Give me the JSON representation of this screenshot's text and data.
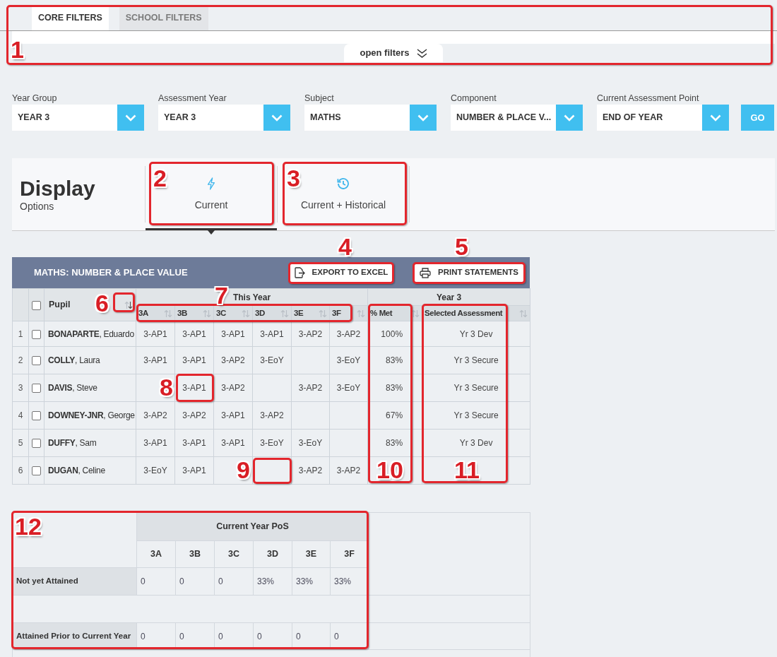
{
  "filter_tabs": [
    {
      "label": "CORE FILTERS",
      "selected": true
    },
    {
      "label": "SCHOOL FILTERS",
      "selected": false
    }
  ],
  "open_filters": "open filters",
  "filters": [
    {
      "label": "Year Group",
      "value": "YEAR 3"
    },
    {
      "label": "Assessment Year",
      "value": "YEAR 3"
    },
    {
      "label": "Subject",
      "value": "MATHS"
    },
    {
      "label": "Component",
      "value": "NUMBER & PLACE V..."
    },
    {
      "label": "Current Assessment Point",
      "value": "END OF YEAR"
    }
  ],
  "go_button": "GO",
  "display_options": {
    "title": "Display",
    "subtitle": "Options",
    "tabs": [
      {
        "label": "Current",
        "kind": "current",
        "selected": true
      },
      {
        "label": "Current + Historical",
        "kind": "historical",
        "selected": false
      }
    ]
  },
  "table": {
    "title": "MATHS: NUMBER & PLACE VALUE",
    "actions": [
      {
        "label": "EXPORT TO EXCEL",
        "kind": "export"
      },
      {
        "label": "PRINT STATEMENTS",
        "kind": "print"
      }
    ],
    "header_checkbox": {
      "checked": false
    },
    "pupil_column": {
      "label": "Pupil",
      "sorted": true
    },
    "column_groups": [
      {
        "label": "This Year",
        "columns": [
          {
            "label": "3A",
            "kind": "mark",
            "sorted": false
          },
          {
            "label": "3B",
            "kind": "mark",
            "sorted": false
          },
          {
            "label": "3C",
            "kind": "mark",
            "sorted": false
          },
          {
            "label": "3D",
            "kind": "mark",
            "sorted": false
          },
          {
            "label": "3E",
            "kind": "mark",
            "sorted": false
          },
          {
            "label": "3F",
            "kind": "mark",
            "sorted": false
          }
        ]
      },
      {
        "label": "Year 3",
        "columns": [
          {
            "label": "% Met",
            "kind": "percent",
            "sorted": false
          },
          {
            "label": "Selected Assessment",
            "kind": "assessment",
            "sorted": false
          }
        ]
      }
    ],
    "rows": [
      {
        "number": "1",
        "checked": false,
        "name": "**BONAPARTE**, Eduardo",
        "cells": [
          "3-AP1",
          "3-AP1",
          "3-AP1",
          "3-AP1",
          "3-AP2",
          "3-AP2",
          "100%",
          "Yr 3 Dev"
        ]
      },
      {
        "number": "2",
        "checked": false,
        "name": "**COLLY**, Laura",
        "cells": [
          "3-AP1",
          "3-AP1",
          "3-AP2",
          "3-EoY",
          null,
          "3-EoY",
          "83%",
          "Yr 3 Secure"
        ]
      },
      {
        "number": "3",
        "checked": false,
        "name": "**DAVIS**, Steve",
        "cells": [
          null,
          "3-AP1",
          "3-AP2",
          null,
          "3-AP2",
          "3-EoY",
          "83%",
          "Yr 3 Secure"
        ]
      },
      {
        "number": "4",
        "checked": false,
        "name": "**DOWNEY-JNR**, George",
        "cells": [
          "3-AP2",
          "3-AP2",
          "3-AP1",
          "3-AP2",
          null,
          null,
          "67%",
          "Yr 3 Secure"
        ]
      },
      {
        "number": "5",
        "checked": false,
        "name": "**DUFFY**, Sam",
        "cells": [
          "3-AP1",
          "3-AP1",
          "3-AP1",
          "3-EoY",
          "3-EoY",
          null,
          "83%",
          "Yr 3 Dev"
        ]
      },
      {
        "number": "6",
        "checked": false,
        "name": "**DUGAN**, Celine",
        "cells": [
          "3-EoY",
          "3-AP1",
          null,
          null,
          "3-AP2",
          "3-AP2",
          null,
          null
        ]
      }
    ]
  },
  "summary": {
    "column_group": "Current Year PoS",
    "columns": [
      "3A",
      "3B",
      "3C",
      "3D",
      "3E",
      "3F"
    ],
    "rows": [
      {
        "label": "Not yet Attained",
        "values": [
          "0",
          "0",
          "0",
          "33%",
          "33%",
          "33%"
        ]
      },
      {
        "label": "Attained Prior to Current Year",
        "values": [
          "0",
          "0",
          "0",
          "0",
          "0",
          "0"
        ]
      }
    ]
  },
  "callouts": [
    "1",
    "2",
    "3",
    "4",
    "5",
    "6",
    "7",
    "8",
    "9",
    "10",
    "11",
    "12"
  ]
}
